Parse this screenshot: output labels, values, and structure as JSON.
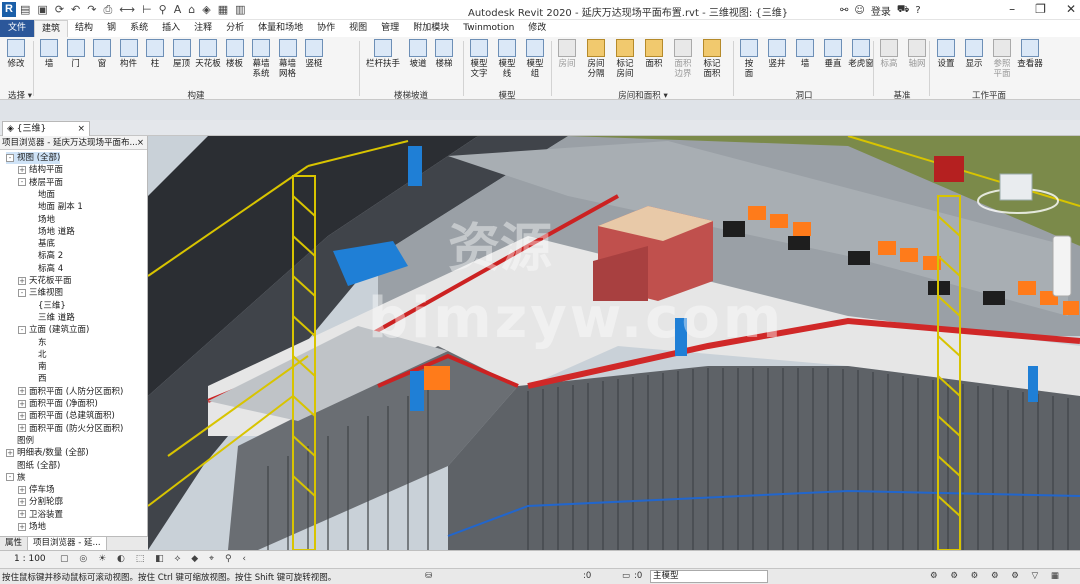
{
  "app": {
    "title": "Autodesk Revit 2020 - 延庆万达现场平面布置.rvt - 三维视图: {三维}",
    "logo": "R",
    "login": "登录"
  },
  "qat_icons": [
    "open-icon",
    "save-icon",
    "sync-icon",
    "undo-icon",
    "redo-icon",
    "print-icon",
    "measure-icon",
    "dimension-icon",
    "tag-icon",
    "text-icon",
    "3d-view-icon",
    "section-icon",
    "close-hidden-icon",
    "switch-window-icon"
  ],
  "tabs": [
    "文件",
    "建筑",
    "结构",
    "钢",
    "系统",
    "插入",
    "注释",
    "分析",
    "体量和场地",
    "协作",
    "视图",
    "管理",
    "附加模块",
    "Twinmotion",
    "修改"
  ],
  "active_tab": "建筑",
  "ribbon": {
    "modify": {
      "label": "修改"
    },
    "build_buttons": [
      "墙",
      "门",
      "窗",
      "构件",
      "柱",
      "屋顶",
      "天花板",
      "楼板",
      "幕墙\n系统",
      "幕墙\n网格",
      "竖梃"
    ],
    "stair_buttons": [
      "栏杆扶手",
      "坡道",
      "楼梯"
    ],
    "model_buttons": [
      "模型\n文字",
      "模型\n线",
      "模型\n组"
    ],
    "room_buttons": [
      "房间",
      "房间\n分隔",
      "标记\n房间",
      "面积",
      "面积\n边界",
      "标记\n面积"
    ],
    "opening_buttons": [
      "按\n面",
      "竖井",
      "墙",
      "垂直",
      "老虎窗"
    ],
    "datum_buttons": [
      "标高",
      "轴网"
    ],
    "workplane_buttons": [
      "设置",
      "显示",
      "参照\n平面",
      "查看器"
    ],
    "panels": [
      "选择 ▾",
      "构建",
      "楼梯坡道",
      "模型",
      "房间和面积 ▾",
      "洞口",
      "基准",
      "工作平面"
    ]
  },
  "view_tab": {
    "label": "{三维}",
    "close": "×"
  },
  "browser": {
    "title": "项目浏览器 - 延庆万达现场平面布...",
    "close": "×",
    "items": [
      {
        "label": "视图 (全部)",
        "level": 0,
        "toggle": "-",
        "selected": true
      },
      {
        "label": "结构平面",
        "level": 1,
        "toggle": "+"
      },
      {
        "label": "楼层平面",
        "level": 1,
        "toggle": "-"
      },
      {
        "label": "地面",
        "level": 2
      },
      {
        "label": "地面 副本 1",
        "level": 2
      },
      {
        "label": "场地",
        "level": 2
      },
      {
        "label": "场地 道路",
        "level": 2
      },
      {
        "label": "基底",
        "level": 2
      },
      {
        "label": "标高 2",
        "level": 2
      },
      {
        "label": "标高 4",
        "level": 2
      },
      {
        "label": "天花板平面",
        "level": 1,
        "toggle": "+"
      },
      {
        "label": "三维视图",
        "level": 1,
        "toggle": "-"
      },
      {
        "label": "{三维}",
        "level": 2
      },
      {
        "label": "三维 道路",
        "level": 2
      },
      {
        "label": "立面 (建筑立面)",
        "level": 1,
        "toggle": "-"
      },
      {
        "label": "东",
        "level": 2
      },
      {
        "label": "北",
        "level": 2
      },
      {
        "label": "南",
        "level": 2
      },
      {
        "label": "西",
        "level": 2
      },
      {
        "label": "面积平面 (人防分区面积)",
        "level": 1,
        "toggle": "+"
      },
      {
        "label": "面积平面 (净面积)",
        "level": 1,
        "toggle": "+"
      },
      {
        "label": "面积平面 (总建筑面积)",
        "level": 1,
        "toggle": "+"
      },
      {
        "label": "面积平面 (防火分区面积)",
        "level": 1,
        "toggle": "+"
      },
      {
        "label": "图例",
        "level": 0
      },
      {
        "label": "明细表/数量 (全部)",
        "level": 0,
        "toggle": "+"
      },
      {
        "label": "图纸 (全部)",
        "level": 0
      },
      {
        "label": "族",
        "level": 0,
        "toggle": "-"
      },
      {
        "label": "停车场",
        "level": 1,
        "toggle": "+"
      },
      {
        "label": "分割轮廓",
        "level": 1,
        "toggle": "+"
      },
      {
        "label": "卫浴装置",
        "level": 1,
        "toggle": "+"
      },
      {
        "label": "场地",
        "level": 1,
        "toggle": "+"
      }
    ],
    "bottom_tabs": [
      "属性",
      "项目浏览器 - 延..."
    ]
  },
  "viewport": {
    "watermark_1": "资源",
    "watermark_2": "bimzyw.com",
    "nav_cube": "front-cube"
  },
  "view_control": {
    "scale": "1 : 100"
  },
  "status": {
    "hint": "按住鼠标键并移动鼠标可滚动视图。按住 Ctrl 键可缩放视图。按住 Shift 键可旋转视图。",
    "zero1": ":0",
    "zero2": ":0",
    "model": "主模型"
  },
  "colors": {
    "file_tab": "#2b579a",
    "crane": "#d8c400",
    "fence": "#cc2222",
    "blue_sign": "#1f7fd6"
  }
}
